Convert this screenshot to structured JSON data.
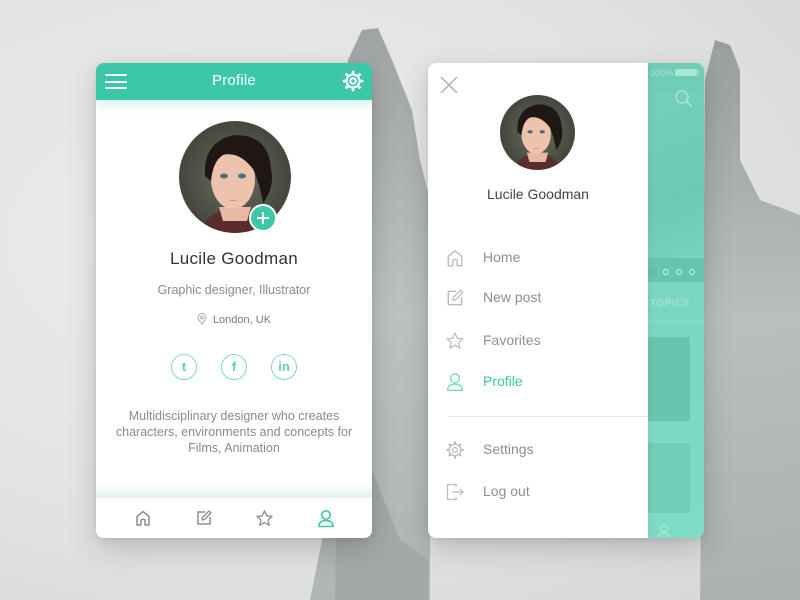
{
  "colors": {
    "accent": "#3cc7a9",
    "accent_light": "#7fdcc6",
    "text_dark": "#333333",
    "text_muted": "#8a8a8a",
    "icon_grey": "#9a9a9a"
  },
  "profile_screen": {
    "header": {
      "title": "Profile",
      "menu_icon": "hamburger-icon",
      "settings_icon": "gear-icon"
    },
    "user": {
      "name": "Lucile Goodman",
      "role": "Graphic designer, Illustrator",
      "location": "London, UK",
      "location_icon": "map-pin-icon",
      "add_photo_icon": "plus-icon",
      "bio": "Multidisciplinary designer who creates characters, environments and concepts for Films, Animation"
    },
    "socials": [
      {
        "name": "twitter",
        "glyph": "t"
      },
      {
        "name": "facebook",
        "glyph": "f"
      },
      {
        "name": "linkedin",
        "glyph": "in"
      }
    ],
    "tabbar": [
      {
        "name": "home",
        "icon": "home-icon",
        "active": false
      },
      {
        "name": "new-post",
        "icon": "edit-icon",
        "active": false
      },
      {
        "name": "favorites",
        "icon": "star-icon",
        "active": false
      },
      {
        "name": "profile",
        "icon": "user-icon",
        "active": true
      }
    ]
  },
  "menu_screen": {
    "close_icon": "close-icon",
    "user_name": "Lucile Goodman",
    "menu_items": [
      {
        "label": "Home",
        "icon": "home-icon",
        "active": false
      },
      {
        "label": "New post",
        "icon": "edit-icon",
        "active": false
      },
      {
        "label": "Favorites",
        "icon": "star-icon",
        "active": false
      },
      {
        "label": "Profile",
        "icon": "user-icon",
        "active": true
      }
    ],
    "secondary_items": [
      {
        "label": "Settings",
        "icon": "gear-icon"
      },
      {
        "label": "Log out",
        "icon": "logout-icon"
      }
    ],
    "background_screen": {
      "battery_text": "100%",
      "section_label": "TOPICS",
      "carousel_dots": 4,
      "carousel_active_index": 0
    }
  }
}
